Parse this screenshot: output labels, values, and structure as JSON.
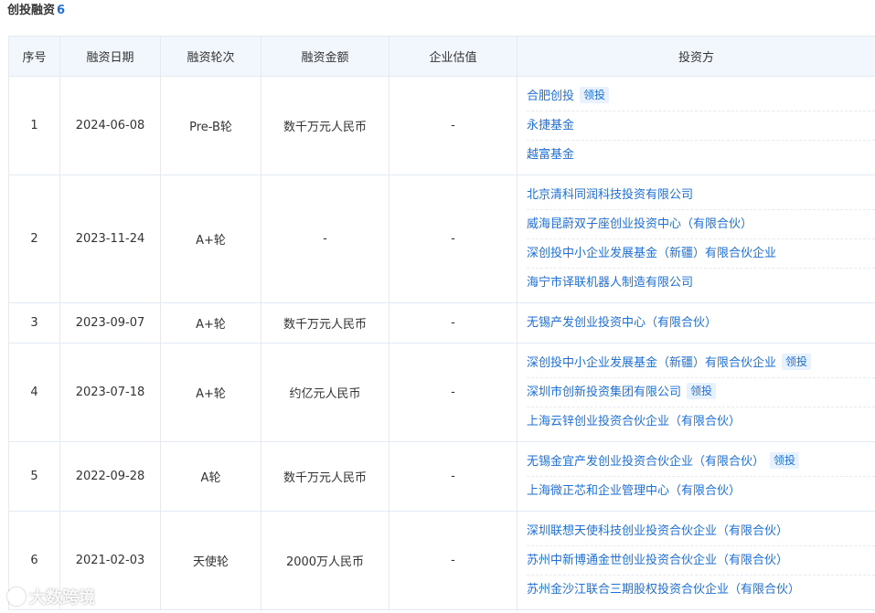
{
  "section": {
    "title": "创投融资",
    "count": "6"
  },
  "columns": [
    "序号",
    "融资日期",
    "融资轮次",
    "融资金额",
    "企业估值",
    "投资方"
  ],
  "rows": [
    {
      "index": "1",
      "date": "2024-06-08",
      "round": "Pre-B轮",
      "amount": "数千万元人民币",
      "valuation": "-",
      "investors": [
        {
          "name": "合肥创投",
          "lead": "领投"
        },
        {
          "name": "永捷基金"
        },
        {
          "name": "越富基金"
        }
      ]
    },
    {
      "index": "2",
      "date": "2023-11-24",
      "round": "A+轮",
      "amount": "-",
      "valuation": "-",
      "investors": [
        {
          "name": "北京清科同润科技投资有限公司"
        },
        {
          "name": "威海昆蔚双子座创业投资中心（有限合伙）"
        },
        {
          "name": "深创投中小企业发展基金（新疆）有限合伙企业"
        },
        {
          "name": "海宁市译联机器人制造有限公司"
        }
      ]
    },
    {
      "index": "3",
      "date": "2023-09-07",
      "round": "A+轮",
      "amount": "数千万元人民币",
      "valuation": "-",
      "investors": [
        {
          "name": "无锡产发创业投资中心（有限合伙）"
        }
      ]
    },
    {
      "index": "4",
      "date": "2023-07-18",
      "round": "A+轮",
      "amount": "约亿元人民币",
      "valuation": "-",
      "investors": [
        {
          "name": "深创投中小企业发展基金（新疆）有限合伙企业",
          "lead": "领投"
        },
        {
          "name": "深圳市创新投资集团有限公司",
          "lead": "领投"
        },
        {
          "name": "上海云锌创业投资合伙企业（有限合伙）"
        }
      ]
    },
    {
      "index": "5",
      "date": "2022-09-28",
      "round": "A轮",
      "amount": "数千万元人民币",
      "valuation": "-",
      "investors": [
        {
          "name": "无锡金宜产发创业投资合伙企业（有限合伙）",
          "lead": "领投"
        },
        {
          "name": "上海微正芯和企业管理中心（有限合伙）"
        }
      ]
    },
    {
      "index": "6",
      "date": "2021-02-03",
      "round": "天使轮",
      "amount": "2000万人民币",
      "valuation": "-",
      "investors": [
        {
          "name": "深圳联想天使科技创业投资合伙企业（有限合伙）"
        },
        {
          "name": "苏州中新博通金世创业投资合伙企业（有限合伙）"
        },
        {
          "name": "苏州金沙江联合三期股权投资合伙企业（有限合伙）"
        }
      ]
    }
  ],
  "watermark": {
    "text": "大数跨境"
  }
}
